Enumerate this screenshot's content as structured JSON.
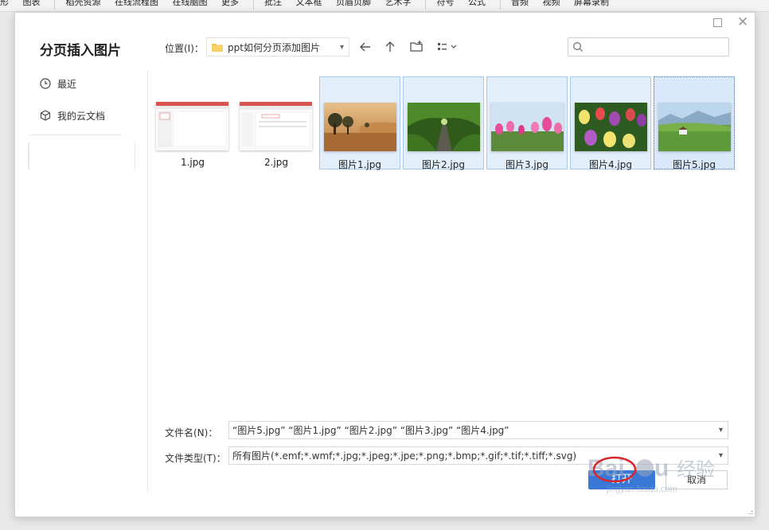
{
  "app_toolbar": {
    "items": [
      "形",
      "图表",
      "稻壳资源",
      "在线流程图",
      "在线脑图",
      "更多",
      "批注",
      "文本框",
      "页眉页脚",
      "艺术字",
      "符号",
      "公式",
      "音频",
      "视频",
      "屏幕录制"
    ]
  },
  "dialog": {
    "title": "分页插入图片",
    "sidebar": {
      "items": [
        {
          "label": "最近",
          "icon": "clock-icon"
        },
        {
          "label": "我的云文档",
          "icon": "cloud-doc-icon"
        }
      ]
    },
    "location": {
      "label": "位置(I)：",
      "folder": "ppt如何分页添加图片"
    },
    "search": {
      "placeholder": ""
    },
    "files": [
      {
        "name": "1.jpg",
        "selected": false
      },
      {
        "name": "2.jpg",
        "selected": false
      },
      {
        "name": "图片1.jpg",
        "selected": true
      },
      {
        "name": "图片2.jpg",
        "selected": true
      },
      {
        "name": "图片3.jpg",
        "selected": true
      },
      {
        "name": "图片4.jpg",
        "selected": true
      },
      {
        "name": "图片5.jpg",
        "selected": true
      }
    ],
    "filename": {
      "label": "文件名(N)：",
      "value": "“图片5.jpg” “图片1.jpg” “图片2.jpg” “图片3.jpg” “图片4.jpg”"
    },
    "filetype": {
      "label": "文件类型(T)：",
      "value": "所有图片(*.emf;*.wmf;*.jpg;*.jpeg;*.jpe;*.png;*.bmp;*.gif;*.tif;*.tiff;*.svg)"
    },
    "buttons": {
      "open": "打开",
      "cancel": "取消"
    },
    "watermark": {
      "brand": "Baidu",
      "text": "经验",
      "url": "jingyan.baidu.com"
    }
  },
  "colors": {
    "accent": "#3a78d8",
    "selection_bg": "#e3eefb",
    "selection_border": "#a8c9ee"
  }
}
